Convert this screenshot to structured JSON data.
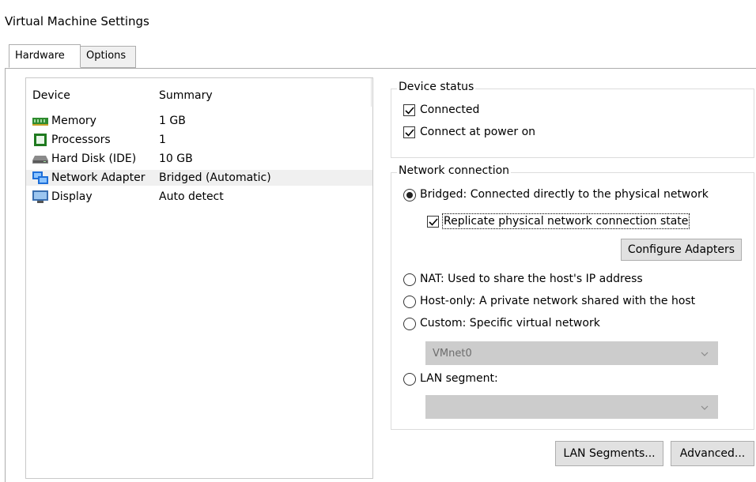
{
  "window": {
    "title": "Virtual Machine Settings"
  },
  "tabs": [
    {
      "label": "Hardware",
      "active": true
    },
    {
      "label": "Options",
      "active": false
    }
  ],
  "device_list": {
    "headers": {
      "device": "Device",
      "summary": "Summary"
    },
    "rows": [
      {
        "device": "Memory",
        "summary": "1 GB",
        "icon": "memory-icon",
        "selected": false
      },
      {
        "device": "Processors",
        "summary": "1",
        "icon": "processor-icon",
        "selected": false
      },
      {
        "device": "Hard Disk (IDE)",
        "summary": "10 GB",
        "icon": "hard-disk-icon",
        "selected": false
      },
      {
        "device": "Network Adapter",
        "summary": "Bridged (Automatic)",
        "icon": "network-adapter-icon",
        "selected": true
      },
      {
        "device": "Display",
        "summary": "Auto detect",
        "icon": "display-icon",
        "selected": false
      }
    ]
  },
  "device_status": {
    "title": "Device status",
    "connected": {
      "label": "Connected",
      "checked": true
    },
    "connect_at_power_on": {
      "label": "Connect at power on",
      "checked": true
    }
  },
  "network_connection": {
    "title": "Network connection",
    "bridged": {
      "label": "Bridged: Connected directly to the physical network",
      "selected": true
    },
    "replicate": {
      "label": "Replicate physical network connection state",
      "checked": true
    },
    "configure_adapters": "Configure Adapters",
    "nat": {
      "label": "NAT: Used to share the host's IP address",
      "selected": false
    },
    "host_only": {
      "label": "Host-only: A private network shared with the host",
      "selected": false
    },
    "custom": {
      "label": "Custom: Specific virtual network",
      "selected": false
    },
    "custom_select_value": "VMnet0",
    "lan_segment": {
      "label": "LAN segment:",
      "selected": false
    },
    "lan_select_value": ""
  },
  "buttons": {
    "lan_segments": "LAN Segments...",
    "advanced": "Advanced..."
  },
  "colors": {
    "selected_row": "#f0f0f0",
    "disabled_select": "#cccccc",
    "button_face": "#e1e1e1"
  }
}
